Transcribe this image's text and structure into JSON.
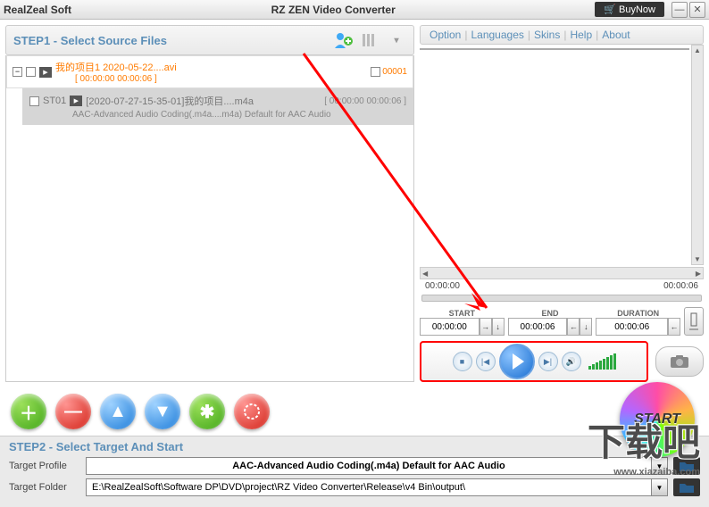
{
  "title_bar": {
    "brand": "RealZeal Soft",
    "app_title": "RZ ZEN Video Converter",
    "buynow": "BuyNow"
  },
  "header_icons": {
    "add": "add-person",
    "bars": "bars",
    "chev": "▾"
  },
  "step1": {
    "title": "STEP1 - Select Source Files",
    "parent": {
      "name": "我的项目1 2020-05-22....avi",
      "dur": "[ 00:00:00  00:00:06 ]",
      "seq": "00001"
    },
    "child": {
      "st": "ST01",
      "name": "[2020-07-27-15-35-01]我的项目....m4a",
      "time": "[ 00:00:00  00:00:06 ]",
      "desc": "AAC-Advanced Audio Coding(.m4a....m4a) Default for AAC Audio"
    }
  },
  "menu": {
    "items": [
      "Option",
      "Languages",
      "Skins",
      "Help",
      "About"
    ]
  },
  "preview": {
    "time_left": "00:00:00",
    "time_right": "00:00:06"
  },
  "sed": {
    "start_lbl": "START",
    "start_val": "00:00:00",
    "end_lbl": "END",
    "end_val": "00:00:06",
    "dur_lbl": "DURATION",
    "dur_val": "00:00:06"
  },
  "step2": {
    "title": "STEP2 - Select Target And Start",
    "profile_lbl": "Target Profile",
    "profile_val": "AAC-Advanced Audio Coding(.m4a) Default for AAC Audio",
    "folder_lbl": "Target Folder",
    "folder_val": "E:\\RealZealSoft\\Software DP\\DVD\\project\\RZ Video Converter\\Release\\v4 Bin\\output\\",
    "start_btn": "START"
  },
  "watermark": {
    "text": "下载吧",
    "url": "www.xiazaiba.com"
  }
}
